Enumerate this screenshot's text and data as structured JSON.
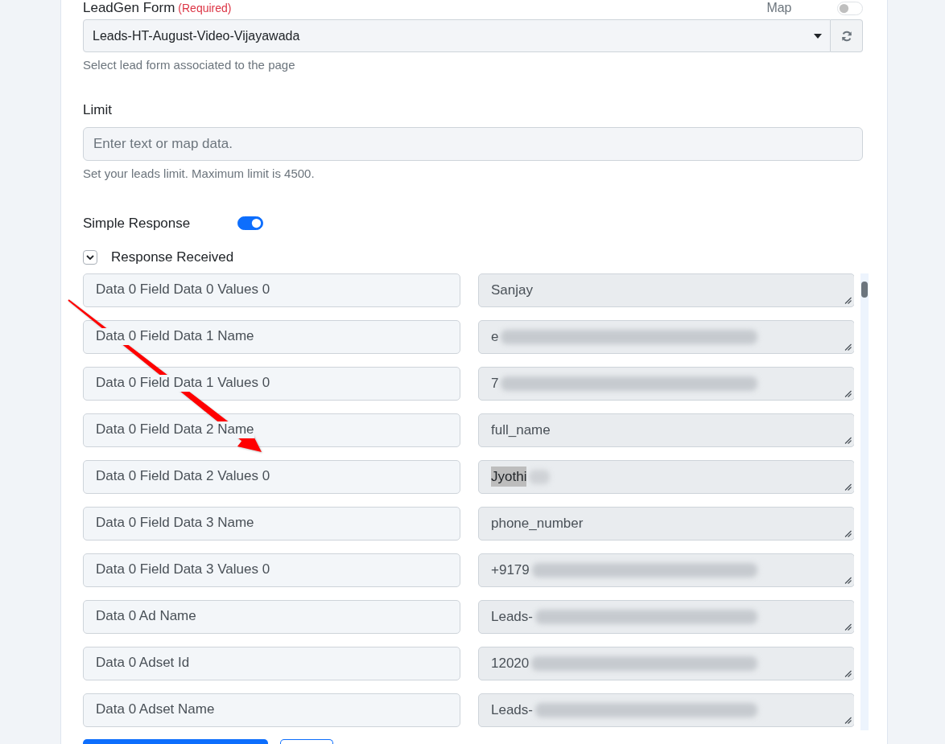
{
  "leadgen_form": {
    "label": "LeadGen Form",
    "required_note": "(Required)",
    "map_label": "Map",
    "map_on": false,
    "value": "Leads-HT-August-Video-Vijayawada",
    "help": "Select lead form associated to the page"
  },
  "limit": {
    "label": "Limit",
    "placeholder": "Enter text or map data.",
    "help": "Set your leads limit. Maximum limit is 4500."
  },
  "simple_response": {
    "label": "Simple Response",
    "on": true
  },
  "response_received": {
    "label": "Response Received",
    "expanded": true,
    "rows": [
      {
        "label": "Data 0 Field Data 0 Values 0",
        "value": "Sanjay",
        "kind": "plain",
        "highlighted": false
      },
      {
        "label": "Data 0 Field Data 1 Name",
        "value": "e",
        "kind": "blurred",
        "highlighted": false
      },
      {
        "label": "Data 0 Field Data 1 Values 0",
        "value": "7",
        "kind": "blurred",
        "highlighted": false
      },
      {
        "label": "Data 0 Field Data 2 Name",
        "value": "full_name",
        "kind": "plain",
        "highlighted": false
      },
      {
        "label": "Data 0 Field Data 2 Values 0",
        "value": "Jyothi",
        "kind": "smudged",
        "highlighted": true
      },
      {
        "label": "Data 0 Field Data 3 Name",
        "value": "phone_number",
        "kind": "plain",
        "highlighted": false
      },
      {
        "label": "Data 0 Field Data 3 Values 0",
        "value": "+9179",
        "kind": "blurred",
        "highlighted": false
      },
      {
        "label": "Data 0 Ad Name",
        "value": "Leads-",
        "kind": "blurred",
        "highlighted": false
      },
      {
        "label": "Data 0 Adset Id",
        "value": "12020",
        "kind": "blurred",
        "highlighted": false
      },
      {
        "label": "Data 0 Adset Name",
        "value": "Leads-",
        "kind": "blurred",
        "highlighted": false
      }
    ]
  },
  "buttons": [
    {
      "kind": "primary"
    },
    {
      "kind": "outline"
    }
  ],
  "annotation": {
    "kind": "arrow"
  }
}
